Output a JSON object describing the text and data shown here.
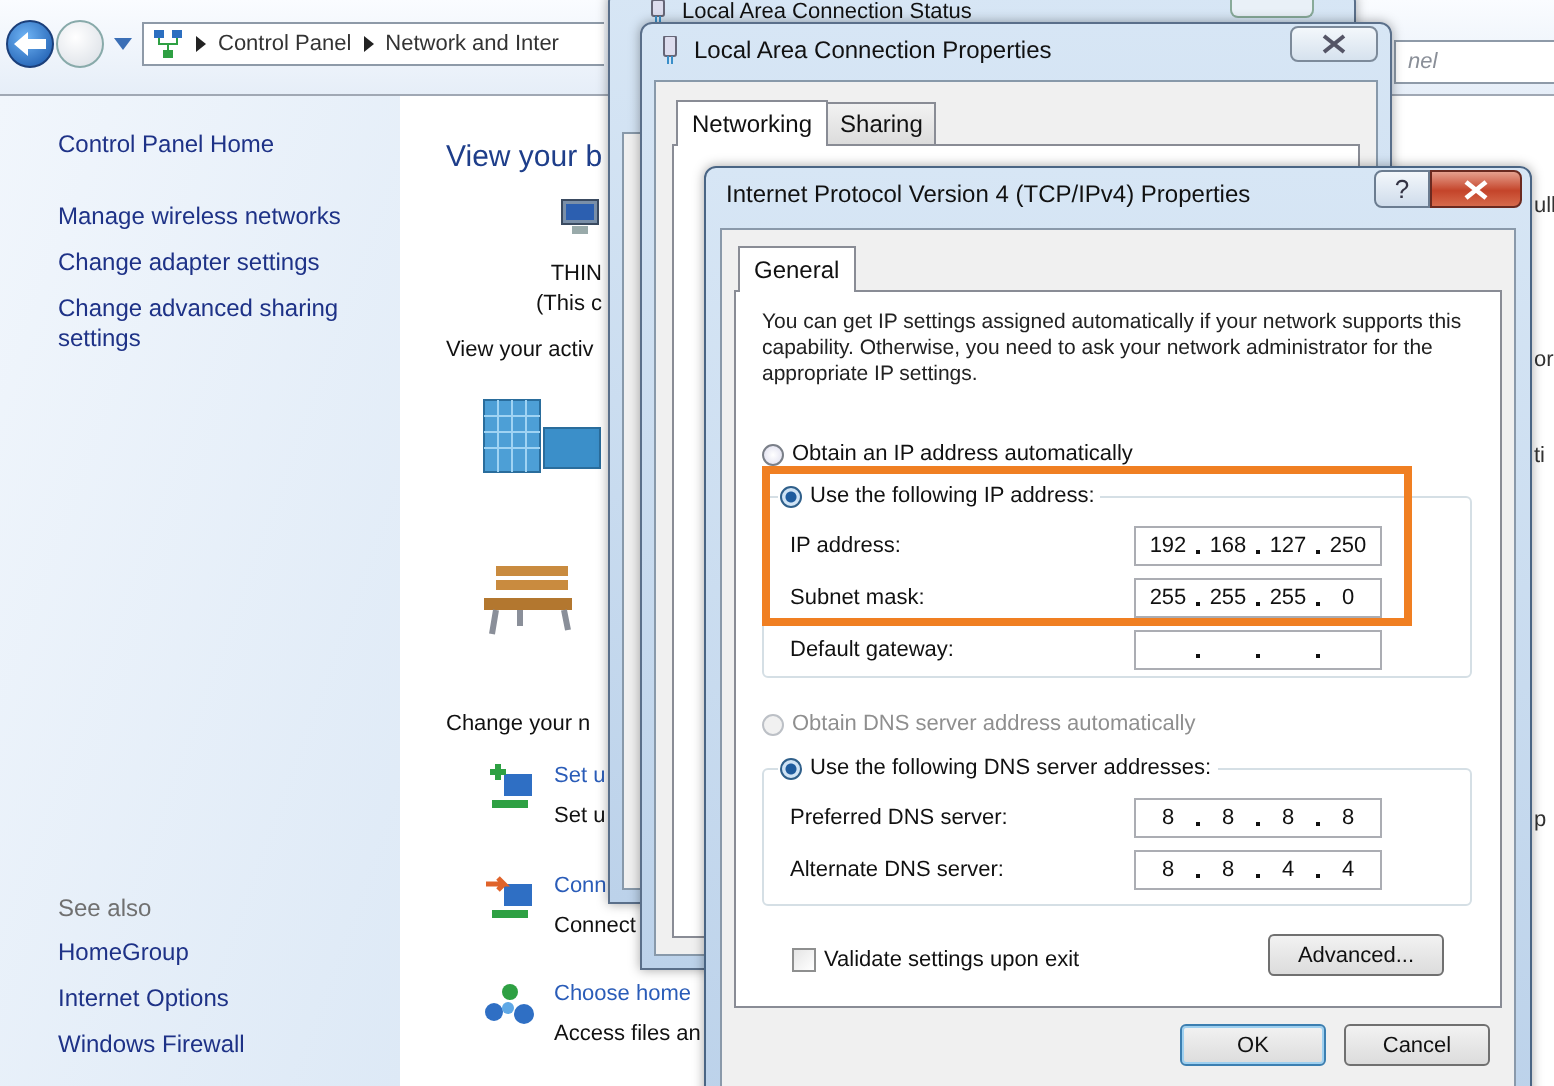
{
  "explorer": {
    "breadcrumb": [
      "Control Panel",
      "Network and Inter"
    ],
    "search": {
      "placeholder": "nel"
    },
    "sidebar": {
      "links": [
        "Control Panel Home",
        "Manage wireless networks",
        "Change adapter settings",
        "Change advanced sharing settings"
      ],
      "see_also_title": "See also",
      "see_also": [
        "HomeGroup",
        "Internet Options",
        "Windows Firewall"
      ]
    },
    "main": {
      "heading": "View your b",
      "computer_name": "THIN",
      "computer_note": "(This c",
      "active_heading": "View your activ",
      "change_heading": "Change your n",
      "tasks": [
        {
          "kind": "add",
          "title": "Set u",
          "description": "Set u"
        },
        {
          "kind": "connect",
          "title": "Conn",
          "description": "Connect"
        },
        {
          "kind": "homegroup",
          "title": "Choose home",
          "description": "Access files an"
        }
      ],
      "edge_fragments": [
        "ull",
        "or",
        "ti",
        "p"
      ]
    }
  },
  "status_window": {
    "title": "Local Area Connection Status"
  },
  "properties_window": {
    "title": "Local Area Connection Properties",
    "tabs": [
      {
        "label": "Networking",
        "selected": true
      },
      {
        "label": "Sharing",
        "selected": false
      }
    ]
  },
  "ipv4_dialog": {
    "title": "Internet Protocol Version 4 (TCP/IPv4) Properties",
    "help": "?",
    "tabs": [
      {
        "label": "General",
        "selected": true
      }
    ],
    "description": "You can get IP settings assigned automatically if your network supports this capability. Otherwise, you need to ask your network administrator for the appropriate IP settings.",
    "ip_options": [
      {
        "label": "Obtain an IP address automatically",
        "selected": false,
        "disabled": false
      },
      {
        "label": "Use the following IP address:",
        "selected": true,
        "disabled": false
      }
    ],
    "ip_fields": [
      {
        "label": "IP address:",
        "octets": [
          "192",
          "168",
          "127",
          "250"
        ]
      },
      {
        "label": "Subnet mask:",
        "octets": [
          "255",
          "255",
          "255",
          "0"
        ]
      },
      {
        "label": "Default gateway:"
      }
    ],
    "dns_options": [
      {
        "label": "Obtain DNS server address automatically",
        "selected": false,
        "disabled": true
      },
      {
        "label": "Use the following DNS server addresses:",
        "selected": true,
        "disabled": false
      }
    ],
    "dns_fields": [
      {
        "label": "Preferred DNS server:",
        "octets": [
          "8",
          "8",
          "8",
          "8"
        ]
      },
      {
        "label": "Alternate DNS server:",
        "octets": [
          "8",
          "8",
          "4",
          "4"
        ]
      }
    ],
    "validate": {
      "label": "Validate settings upon exit",
      "checked": false
    },
    "advanced_button": "Advanced...",
    "buttons": [
      {
        "label": "OK",
        "default": true
      },
      {
        "label": "Cancel",
        "default": false
      }
    ]
  }
}
